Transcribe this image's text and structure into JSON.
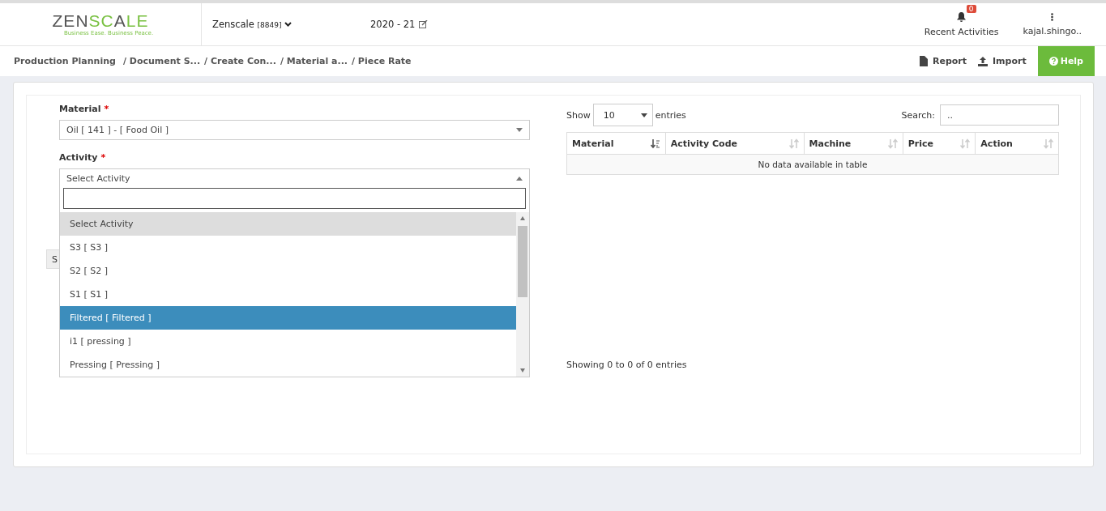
{
  "header": {
    "logo": {
      "dark": "ZENSC",
      "mark": "A",
      "light": "LE",
      "tagline": "Business Ease. Business Peace."
    },
    "company": {
      "name": "Zenscale",
      "code": "[8849]"
    },
    "year": "2020 - 21",
    "notifications": {
      "label": "Recent Activities",
      "count": "0"
    },
    "user": "kajal.shingo.."
  },
  "breadcrumb": [
    "Production Planning",
    "/ Document S...",
    "/ Create Con...",
    "/ Material a...",
    "/ Piece Rate"
  ],
  "actions": [
    {
      "kind": "report",
      "label": "Report"
    },
    {
      "kind": "import",
      "label": "Import"
    },
    {
      "kind": "help",
      "label": "Help"
    }
  ],
  "form": {
    "material": {
      "label": "Material",
      "required_mark": "*",
      "value": "Oil [ 141 ] - [ Food Oil ]"
    },
    "activity": {
      "label": "Activity",
      "required_mark": "*",
      "value": "Select Activity",
      "expanded": true,
      "options": [
        {
          "label": "Select Activity",
          "selected": true,
          "highlighted": false
        },
        {
          "label": "S3 [ S3 ]",
          "selected": false,
          "highlighted": false
        },
        {
          "label": "S2 [ S2 ]",
          "selected": false,
          "highlighted": false
        },
        {
          "label": "S1 [ S1 ]",
          "selected": false,
          "highlighted": false
        },
        {
          "label": "Filtered [ Filtered ]",
          "selected": false,
          "highlighted": true
        },
        {
          "label": "i1 [ pressing ]",
          "selected": false,
          "highlighted": false
        },
        {
          "label": "Pressing [ Pressing ]",
          "selected": false,
          "highlighted": false
        }
      ]
    },
    "hidden_button": "S"
  },
  "table": {
    "show_label": "Show",
    "page_size": "10",
    "entries_label": "entries",
    "search_label": "Search:",
    "search_value": "..",
    "columns": [
      {
        "label": "Material",
        "sorted": true
      },
      {
        "label": "Activity Code",
        "sorted": false
      },
      {
        "label": "Machine",
        "sorted": false
      },
      {
        "label": "Price",
        "sorted": false
      },
      {
        "label": "Action",
        "sorted": false
      }
    ],
    "empty": "No data available in table",
    "info": "Showing 0 to 0 of 0 entries"
  }
}
